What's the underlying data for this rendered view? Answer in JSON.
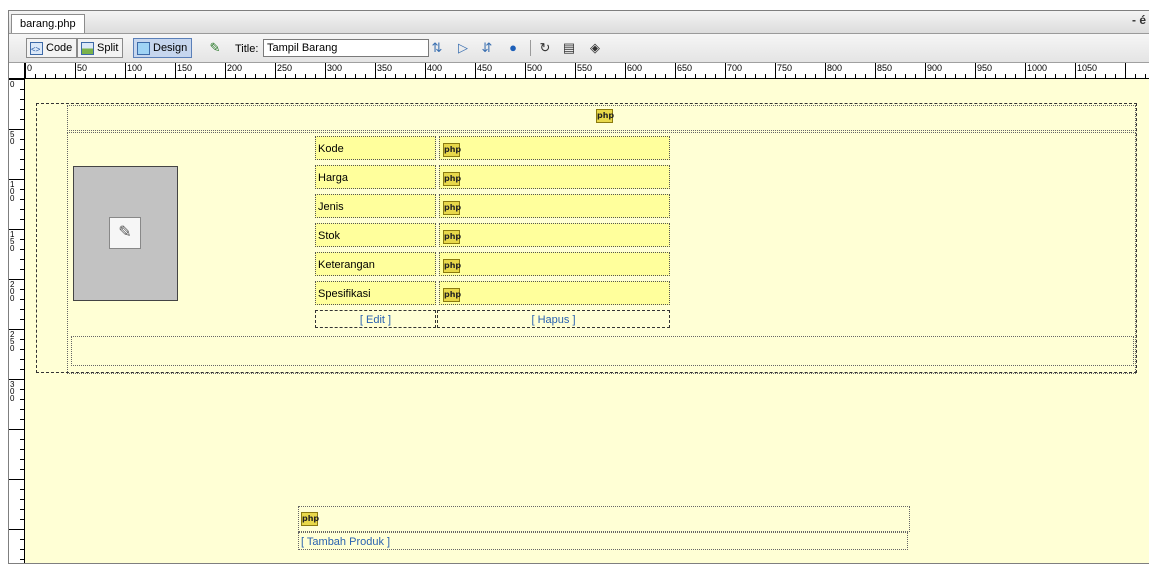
{
  "document": {
    "tab_name": "barang.php",
    "window_control": "- é"
  },
  "toolbar": {
    "code_label": "Code",
    "split_label": "Split",
    "design_label": "Design",
    "title_label": "Title:",
    "title_value": "Tampil Barang",
    "active_view": "Design"
  },
  "ruler": {
    "h_labels": [
      "0",
      "50",
      "100",
      "150",
      "200",
      "250",
      "300",
      "350",
      "400",
      "450",
      "500",
      "550",
      "600",
      "650",
      "700",
      "750",
      "800",
      "850",
      "900",
      "950",
      "1000",
      "1050"
    ],
    "v_labels": [
      "0",
      "50",
      "100",
      "150",
      "200",
      "250",
      "300"
    ]
  },
  "canvas": {
    "php_marker": "php",
    "fields": [
      {
        "label": "Kode"
      },
      {
        "label": "Harga"
      },
      {
        "label": "Jenis"
      },
      {
        "label": "Stok"
      },
      {
        "label": "Keterangan"
      },
      {
        "label": "Spesifikasi"
      }
    ],
    "edit_link": "[ Edit ]",
    "delete_link": "[ Hapus ]",
    "add_product_link": "[ Tambah Produk ]"
  },
  "colors": {
    "canvas_bg": "#ffffd5",
    "cell_bg": "#ffff9c",
    "link_color": "#2a62b0",
    "active_button_bg": "#c6d6ee"
  }
}
